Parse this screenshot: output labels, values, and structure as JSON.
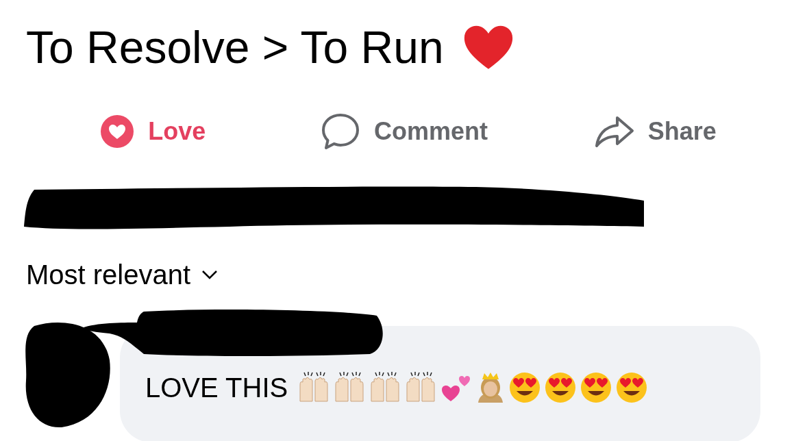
{
  "post": {
    "title": "To Resolve > To Run"
  },
  "actions": [
    {
      "kind": "love",
      "label": "Love",
      "selected": true
    },
    {
      "kind": "comment",
      "label": "Comment",
      "selected": false
    },
    {
      "kind": "share",
      "label": "Share",
      "selected": false
    }
  ],
  "sort": {
    "label": "Most relevant"
  },
  "comment": {
    "text": "LOVE THIS",
    "emojis": [
      {
        "kind": "raised-hands"
      },
      {
        "kind": "raised-hands"
      },
      {
        "kind": "raised-hands"
      },
      {
        "kind": "raised-hands"
      },
      {
        "kind": "hearts"
      },
      {
        "kind": "princess"
      },
      {
        "kind": "heart-eyes"
      },
      {
        "kind": "heart-eyes"
      },
      {
        "kind": "heart-eyes"
      },
      {
        "kind": "heart-eyes"
      }
    ]
  }
}
